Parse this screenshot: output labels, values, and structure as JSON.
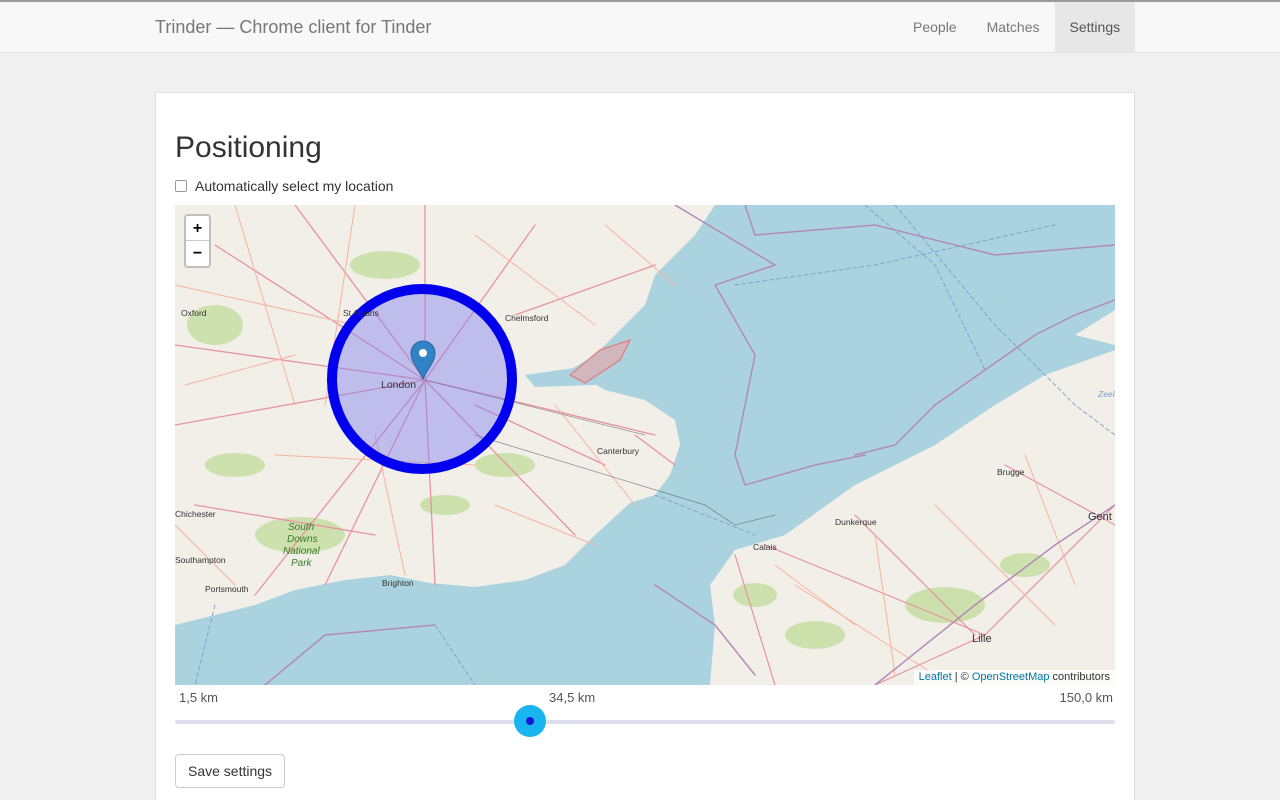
{
  "app": {
    "brand": "Trinder — Chrome client for Tinder"
  },
  "nav": {
    "items": [
      {
        "label": "People",
        "active": false
      },
      {
        "label": "Matches",
        "active": false
      },
      {
        "label": "Settings",
        "active": true
      }
    ]
  },
  "settings": {
    "title": "Positioning",
    "auto_location_label": "Automatically select my location",
    "auto_location_checked": false,
    "save_label": "Save settings"
  },
  "map": {
    "zoom_in": "+",
    "zoom_out": "−",
    "attribution": {
      "leaflet": "Leaflet",
      "separator": " | © ",
      "osm": "OpenStreetMap",
      "suffix": " contributors"
    },
    "labels": {
      "oxford": "Oxford",
      "st_albans": "St Albans",
      "chelmsford": "Chelmsford",
      "london": "London",
      "canterbury": "Canterbury",
      "chester": "Chichester",
      "south": "South",
      "downs": "Downs",
      "national": "National",
      "park": "Park",
      "hampton": "Southampton",
      "portsmouth": "Portsmouth",
      "brighton": "Brighton",
      "dunkerque": "Dunkerque",
      "calais": "Calais",
      "brugge": "Brugge",
      "gent": "Gent",
      "lille": "Lille",
      "zee": "Zeeland"
    },
    "radius_circle_color": "#0000ee",
    "radius_fill_color": "#8080ee"
  },
  "distance": {
    "min_label": "1,5 km",
    "current_label": "34,5 km",
    "max_label": "150,0 km",
    "min": 1.5,
    "max": 150,
    "current": 34.5,
    "accent_color": "#19b5ee"
  }
}
